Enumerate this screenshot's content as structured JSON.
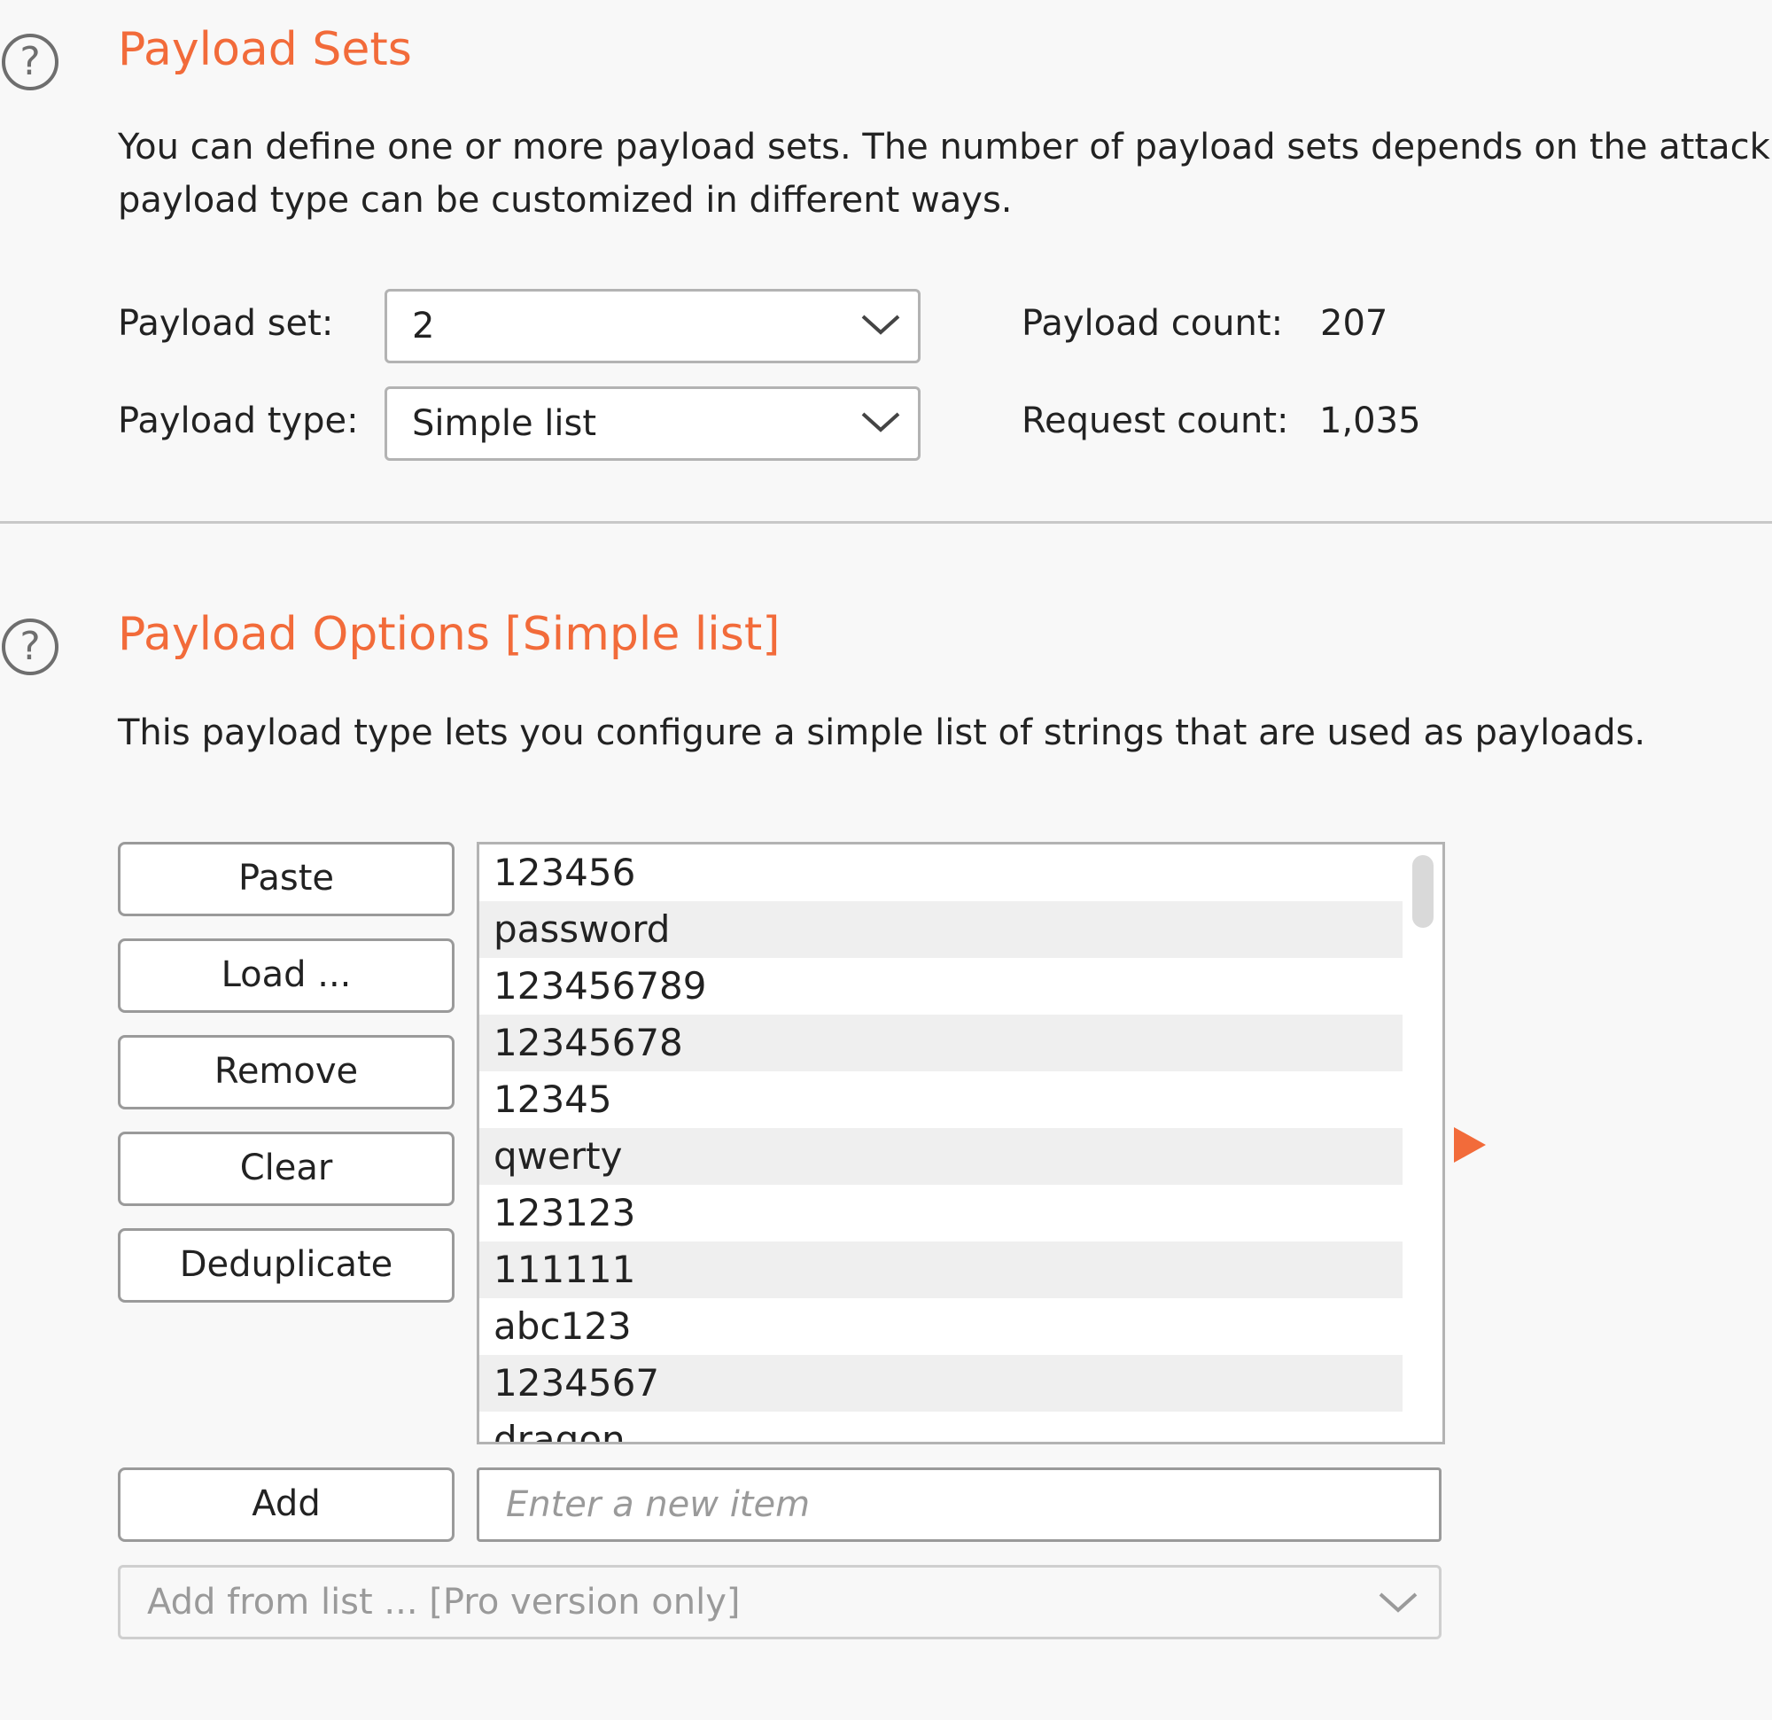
{
  "payload_sets": {
    "title": "Payload Sets",
    "description_line1": "You can define one or more payload sets. The number of payload sets depends on the attack",
    "description_line2": "payload type can be customized in different ways.",
    "payload_set_label": "Payload set:",
    "payload_set_value": "2",
    "payload_type_label": "Payload type:",
    "payload_type_value": "Simple list",
    "payload_count_label": "Payload count:",
    "payload_count_value": "207",
    "request_count_label": "Request count:",
    "request_count_value": "1,035"
  },
  "payload_options": {
    "title": "Payload Options [Simple list]",
    "description": "This payload type lets you configure a simple list of strings that are used as payloads.",
    "buttons": {
      "paste": "Paste",
      "load": "Load ...",
      "remove": "Remove",
      "clear": "Clear",
      "deduplicate": "Deduplicate",
      "add": "Add"
    },
    "list_items": [
      "123456",
      "password",
      "123456789",
      "12345678",
      "12345",
      "qwerty",
      "123123",
      "111111",
      "abc123",
      "1234567",
      "dragon"
    ],
    "new_item_placeholder": "Enter a new item",
    "add_from_list": "Add from list ... [Pro version only]"
  },
  "colors": {
    "accent": "#f26b3a",
    "row_alt": "#efefef"
  },
  "icons": {
    "help": "help-circle-icon",
    "dropdown": "chevron-down-icon",
    "marker": "orange-arrow-icon"
  }
}
